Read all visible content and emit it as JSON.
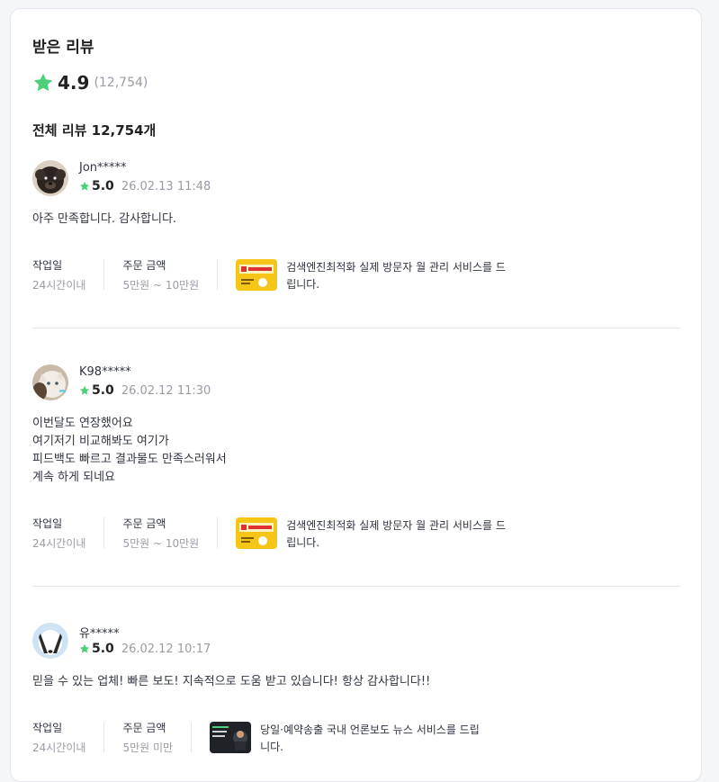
{
  "header": {
    "title": "받은 리뷰",
    "rating": "4.9",
    "rating_count": "(12,754)",
    "total_label": "전체 리뷰 12,754개"
  },
  "colors": {
    "star": "#4ed07a",
    "text": "#303441",
    "muted": "#9a9ba7",
    "border": "#e4e5ed"
  },
  "reviews": [
    {
      "user": "Jon*****",
      "score": "5.0",
      "date": "26.02.13 11:48",
      "content": [
        "아주 만족합니다. 감사합니다."
      ],
      "work_label": "작업일",
      "work_value": "24시간이내",
      "price_label": "주문 금액",
      "price_value": "5만원 ~ 10만원",
      "gig_title": "검색엔진최적화 실제 방문자 월 관리 서비스를 드립니다.",
      "thumb_text": "월방문자관리"
    },
    {
      "user": "K98*****",
      "score": "5.0",
      "date": "26.02.12 11:30",
      "content": [
        "이번달도 연장했어요",
        "여기저기 비교해봐도 여기가",
        "피드백도 빠르고 결과물도 만족스러워서",
        "계속 하게 되네요"
      ],
      "work_label": "작업일",
      "work_value": "24시간이내",
      "price_label": "주문 금액",
      "price_value": "5만원 ~ 10만원",
      "gig_title": "검색엔진최적화 실제 방문자 월 관리 서비스를 드립니다.",
      "thumb_text": "월방문자관리"
    },
    {
      "user": "유*****",
      "score": "5.0",
      "date": "26.02.12 10:17",
      "content": [
        "믿을 수 있는 업체! 빠른 보도! 지속적으로 도움 받고 있습니다! 항상 감사합니다!!"
      ],
      "work_label": "작업일",
      "work_value": "24시간이내",
      "price_label": "주문 금액",
      "price_value": "5만원 미만",
      "gig_title": "당일·예약송출 국내 언론보도 뉴스 서비스를 드립니다.",
      "thumb_text": "국내 언론보도"
    }
  ]
}
